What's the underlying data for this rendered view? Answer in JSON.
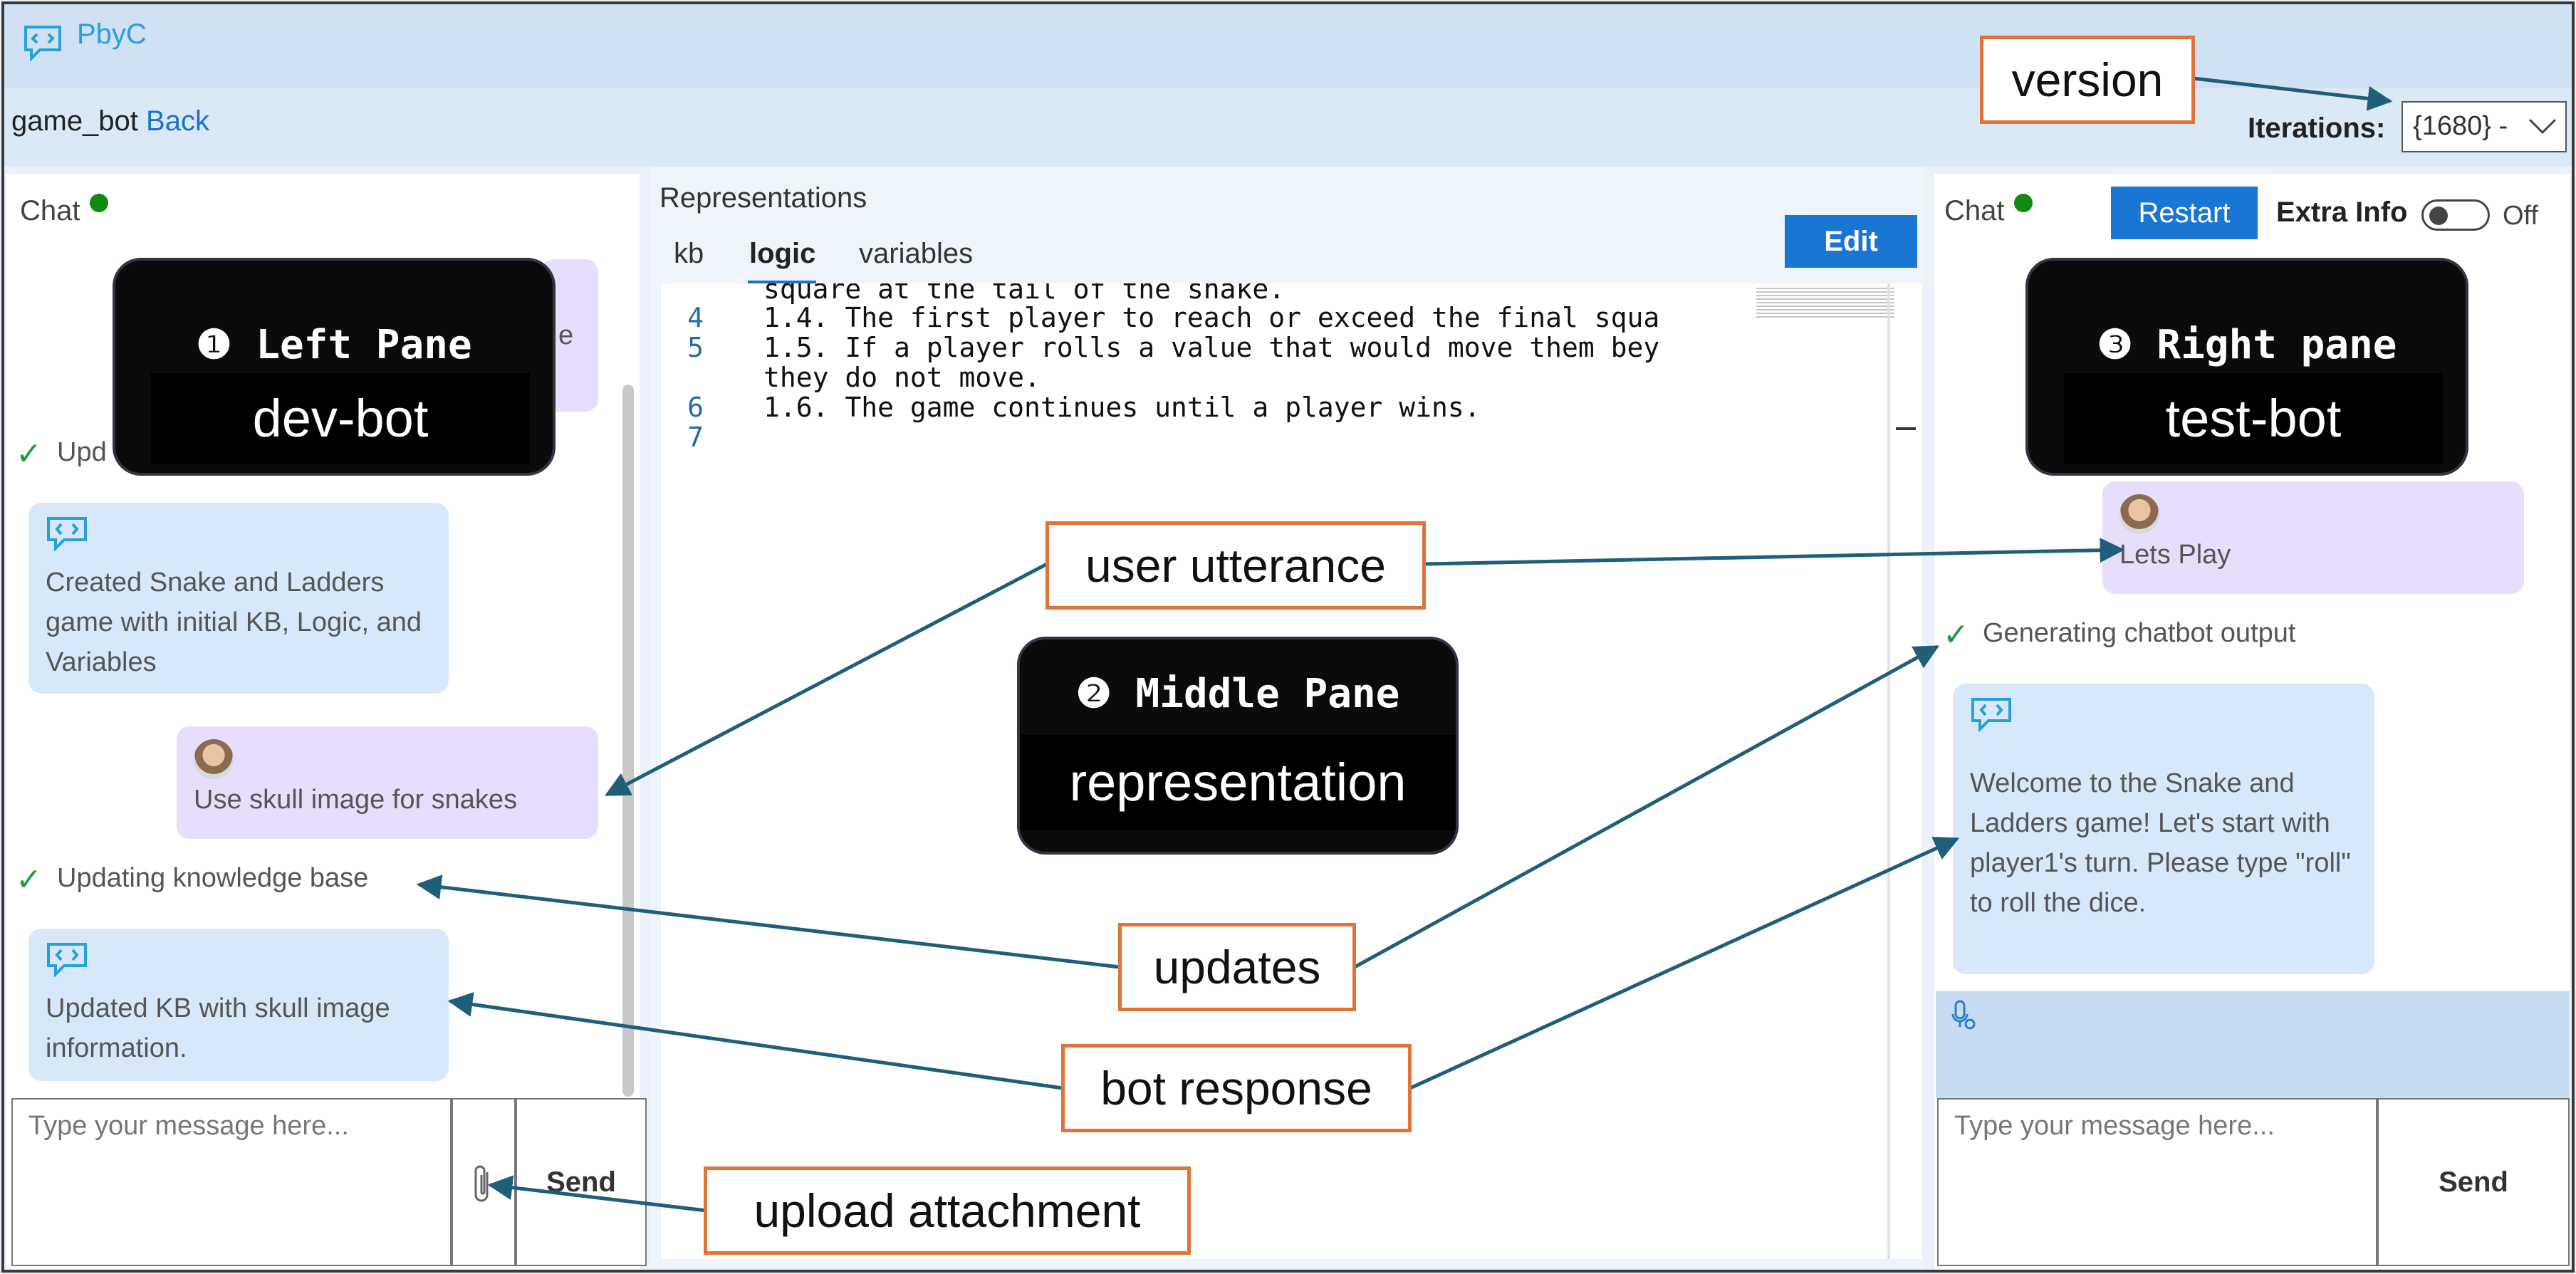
{
  "app": {
    "title": "PbyC"
  },
  "breadcrumb": {
    "bot_name": "game_bot",
    "back_label": "Back"
  },
  "iterations": {
    "label": "Iterations:",
    "selected": "{1680} -"
  },
  "left_pane": {
    "title": "Chat",
    "status_color": "#108a10",
    "messages": [
      {
        "type": "status",
        "text": "Upd"
      },
      {
        "type": "bot",
        "text": "Created Snake and Ladders game with initial KB, Logic, and Variables"
      },
      {
        "type": "user",
        "text": "Use skull image for snakes"
      },
      {
        "type": "status",
        "text": "Updating knowledge base"
      },
      {
        "type": "bot",
        "text": "Updated KB with skull image information."
      }
    ],
    "partial_user_char": "e",
    "input_placeholder": "Type your message here...",
    "send_label": "Send",
    "attach_icon": "paperclip-icon"
  },
  "middle_pane": {
    "title": "Representations",
    "tabs": [
      {
        "label": "kb",
        "active": false
      },
      {
        "label": "logic",
        "active": true
      },
      {
        "label": "variables",
        "active": false
      }
    ],
    "edit_label": "Edit",
    "code": [
      {
        "ln": "",
        "text": "square at the tail of the snake."
      },
      {
        "ln": "4",
        "text": "1.4. The first player to reach or exceed the final squa"
      },
      {
        "ln": "5",
        "text": "1.5. If a player rolls a value that would move them bey"
      },
      {
        "ln": "",
        "text": "they do not move."
      },
      {
        "ln": "6",
        "text": "1.6. The game continues until a player wins."
      },
      {
        "ln": "7",
        "text": ""
      }
    ]
  },
  "right_pane": {
    "title": "Chat",
    "restart_label": "Restart",
    "extra_info_label": "Extra Info",
    "toggle_state": "Off",
    "messages": [
      {
        "type": "user",
        "text": "Lets Play"
      },
      {
        "type": "status",
        "text": "Generating chatbot output"
      },
      {
        "type": "bot",
        "text": "Welcome to the Snake and Ladders game! Let's start with player1's turn. Please type \"roll\" to roll the dice."
      }
    ],
    "input_placeholder": "Type your message here...",
    "send_label": "Send"
  },
  "annotations": {
    "version": "version",
    "user_utterance": "user utterance",
    "updates": "updates",
    "bot_response": "bot response",
    "upload_attachment": "upload attachment",
    "left_title": "❶ Left Pane",
    "left_sub": "dev-bot",
    "middle_title": "❷ Middle Pane",
    "middle_sub": "representation",
    "right_title": "❸ Right pane",
    "right_sub": "test-bot",
    "callout_border_color": "#e0733a",
    "arrow_color": "#1f5f7a"
  }
}
